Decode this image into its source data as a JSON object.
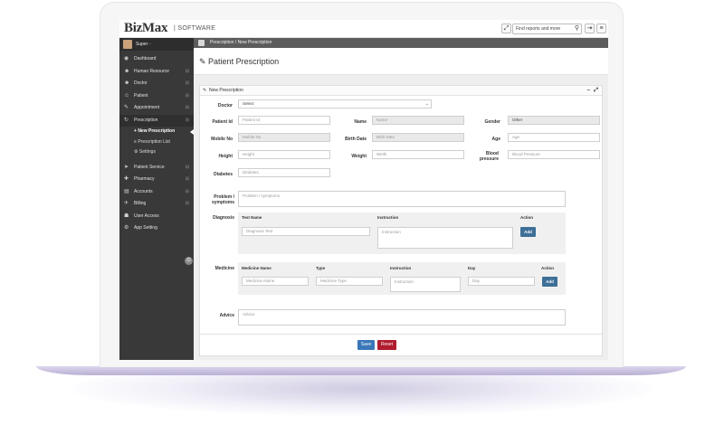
{
  "brand": {
    "name": "BizMax",
    "suffix": "SOFTWARE"
  },
  "topbar": {
    "search_placeholder": "Find reports and more"
  },
  "sidebar": {
    "user": "Super -",
    "items": [
      {
        "label": "Dashboard",
        "icon": "dashboard-icon"
      },
      {
        "label": "Human Resource",
        "icon": "users-icon"
      },
      {
        "label": "Doctor",
        "icon": "user-md-icon"
      },
      {
        "label": "Patient",
        "icon": "user-icon"
      },
      {
        "label": "Appointment",
        "icon": "pencil-icon"
      },
      {
        "label": "Prescription",
        "icon": "prescription-icon"
      },
      {
        "label": "Patient Service",
        "icon": "arrow-icon"
      },
      {
        "label": "Pharmacy",
        "icon": "pharmacy-icon"
      },
      {
        "label": "Accounts",
        "icon": "accounts-icon"
      },
      {
        "label": "Billing",
        "icon": "billing-icon"
      },
      {
        "label": "User Access",
        "icon": "user-access-icon"
      },
      {
        "label": "App Setting",
        "icon": "gear-icon"
      }
    ],
    "subitems": [
      "New Prescription",
      "Prescription List",
      "Settings"
    ]
  },
  "breadcrumb": {
    "parent": "Prescription",
    "sep": "/",
    "current": "New Prescription"
  },
  "page": {
    "title": "Patient Prescription"
  },
  "panel": {
    "title": "New Prescription"
  },
  "form": {
    "doctor_label": "Doctor",
    "doctor_value": "Select",
    "patient_id_label": "Patient Id",
    "patient_id_ph": "Patient Id",
    "name_label": "Name",
    "name_ph": "Name",
    "gender_label": "Gender",
    "gender_value": "Other",
    "mobile_label": "Mobile No",
    "mobile_ph": "Mobile No",
    "birth_label": "Birth Date",
    "birth_ph": "Birth Date",
    "age_label": "Age",
    "age_ph": "Age",
    "height_label": "Height",
    "height_ph": "Height",
    "weight_label": "Weight",
    "weight_ph": "Weith",
    "bp_label": "Blood pressure",
    "bp_ph": "Blood Pressure",
    "diabetes_label": "Diabetes",
    "diabetes_ph": "Diabetes",
    "problem_label": "Problem / symptoms",
    "problem_ph": "Problem / symptoms",
    "diagnosis_label": "Diagnosis",
    "diagnosis_cols": {
      "test": "Test Name",
      "instruction": "Instruction",
      "action": "Action"
    },
    "diagnosis_test_ph": "Diagnosis Test",
    "diagnosis_instruction_ph": "Instruction",
    "medicine_label": "Medicine",
    "medicine_cols": {
      "name": "Medicine Name",
      "type": "Type",
      "instruction": "Instruction",
      "day": "Day",
      "action": "Action"
    },
    "medicine_name_ph": "Medicine Name",
    "medicine_type_ph": "Medicine Type",
    "medicine_instruction_ph": "Instruction",
    "medicine_day_ph": "Day",
    "add_label": "Add",
    "advice_label": "Advice",
    "advice_ph": "Advice",
    "save_label": "Save",
    "reset_label": "Reset"
  }
}
